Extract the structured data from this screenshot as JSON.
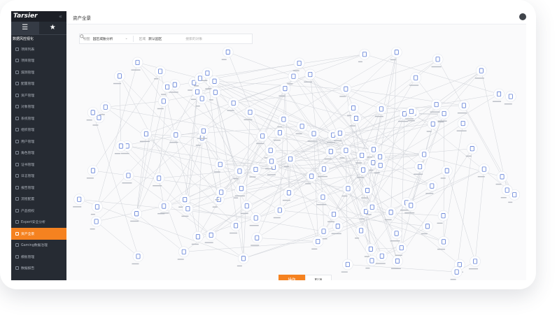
{
  "brand": {
    "logo_text": "Tarsier",
    "collapse_glyph": "«"
  },
  "sidebar": {
    "tabs": [
      {
        "icon": "menu-icon",
        "label": "☰"
      },
      {
        "icon": "star-icon",
        "label": "★"
      }
    ],
    "section_title": "数据风控视化",
    "items": [
      {
        "label": "项目列表",
        "active": false
      },
      {
        "label": "项目管理",
        "active": false
      },
      {
        "label": "漏洞管理",
        "active": false
      },
      {
        "label": "配置管理",
        "active": false
      },
      {
        "label": "资产管理",
        "active": false
      },
      {
        "label": "对象管理",
        "active": false
      },
      {
        "label": "系统管理",
        "active": false
      },
      {
        "label": "组织管理",
        "active": false
      },
      {
        "label": "用户管理",
        "active": false
      },
      {
        "label": "角色管理",
        "active": false
      },
      {
        "label": "证书管理",
        "active": false
      },
      {
        "label": "日志管理",
        "active": false
      },
      {
        "label": "报告管理",
        "active": false
      },
      {
        "label": "流程配置",
        "active": false
      },
      {
        "label": "产品授权",
        "active": false
      },
      {
        "label": "Expert安全分析",
        "active": false
      },
      {
        "label": "资产全景",
        "active": true
      },
      {
        "label": "Gaming数据治理",
        "active": false
      },
      {
        "label": "模板管理",
        "active": false
      },
      {
        "label": "数据报告",
        "active": false
      }
    ]
  },
  "header": {
    "title": "资产全景"
  },
  "filters": {
    "scope_label": "视图",
    "scope_value": "园区威胁分析",
    "area_label": "区域",
    "area_value": "默认园区",
    "search_placeholder": "搜索的对象"
  },
  "actions": {
    "confirm_label": "操作",
    "cancel_label": "取消"
  },
  "colors": {
    "accent": "#f58220",
    "sidebar_bg": "#262b33",
    "node_icon": "#5b7bd5",
    "edge": "#cfd2d8"
  }
}
